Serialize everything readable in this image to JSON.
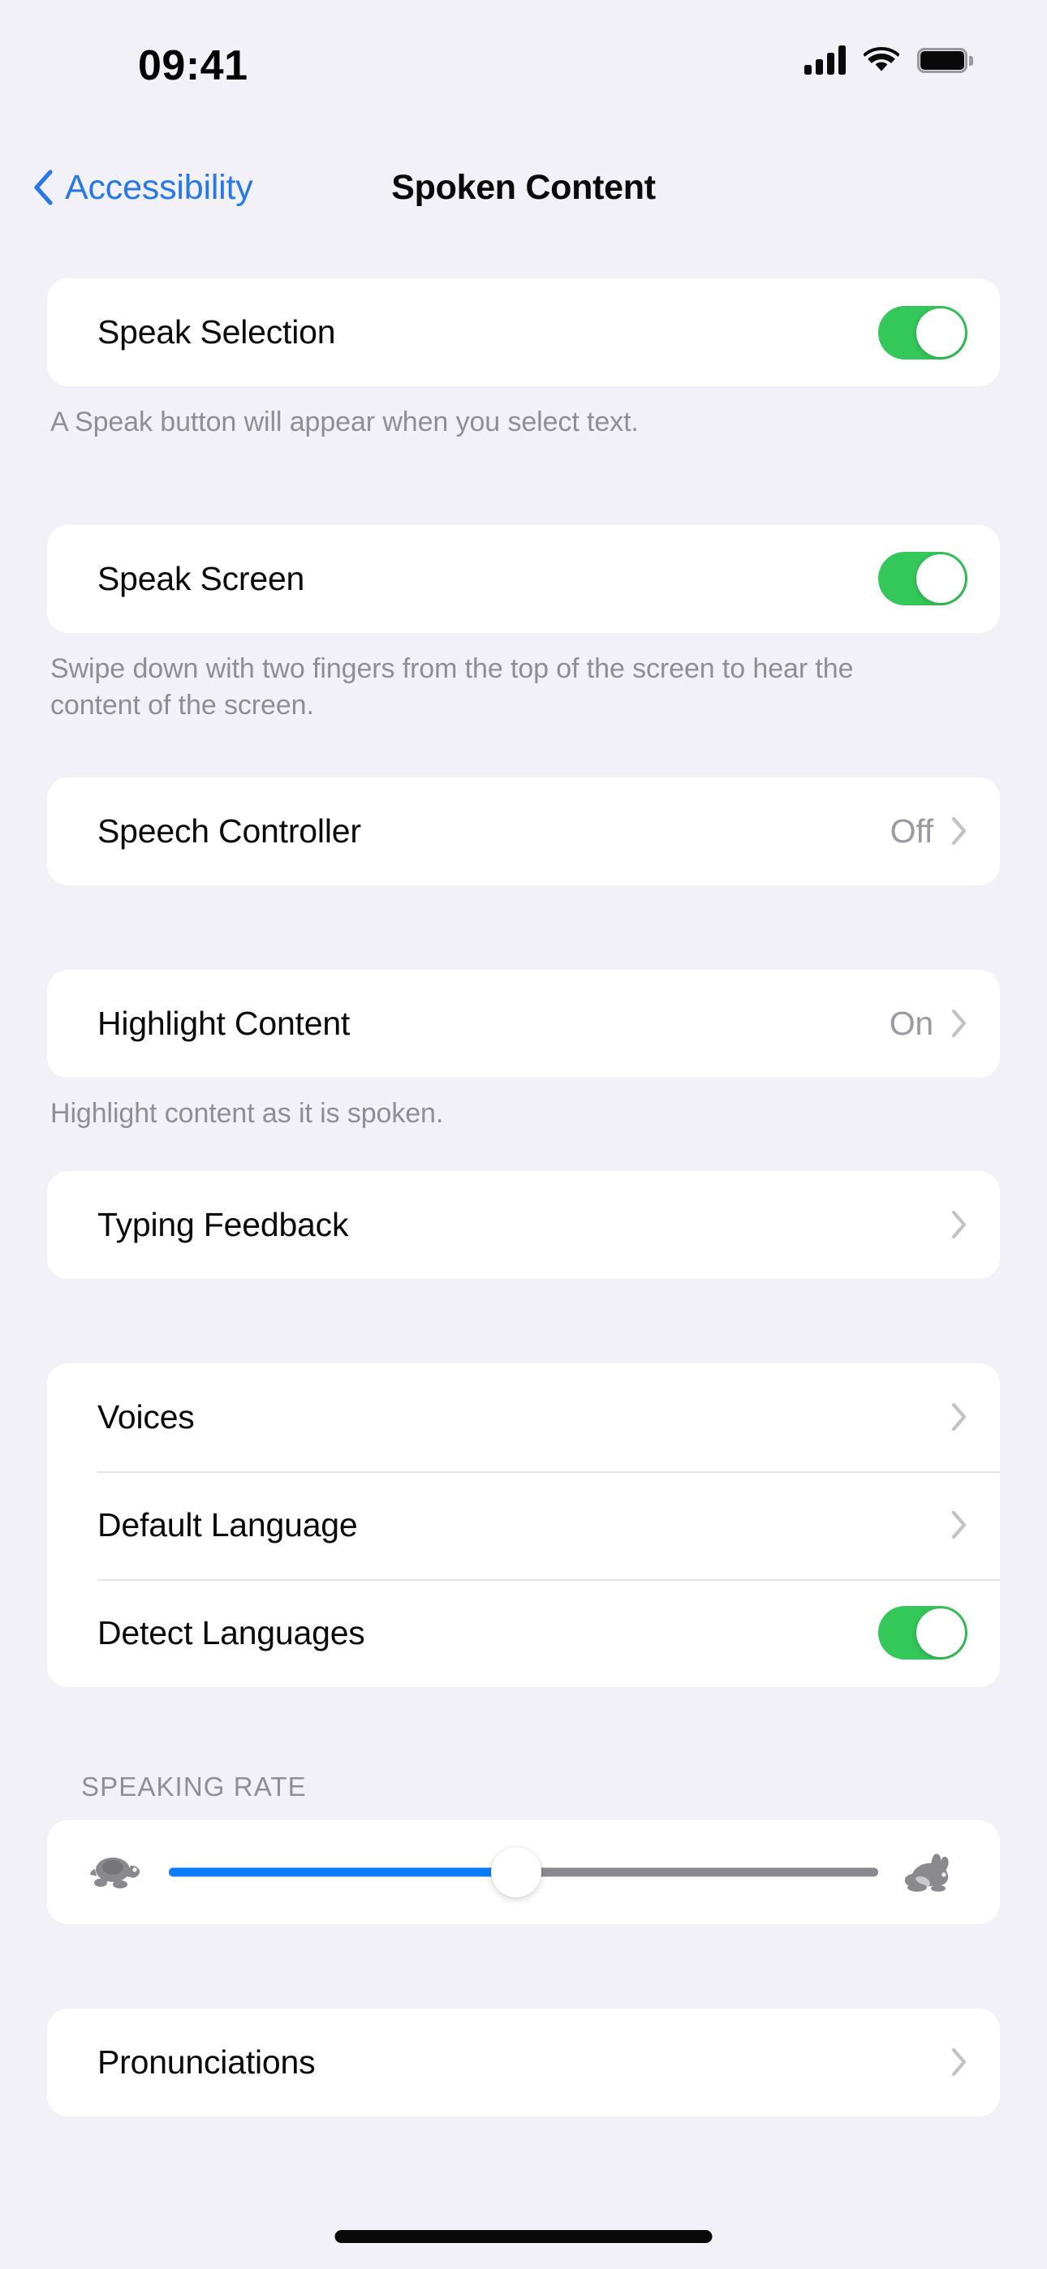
{
  "status_bar": {
    "time": "09:41",
    "cellular_icon": "cellular-signal-icon",
    "cellular_bars": 4,
    "wifi_icon": "wifi-icon",
    "battery_icon": "battery-full-icon",
    "battery_level_percent": 100
  },
  "nav": {
    "back_icon": "chevron-left-icon",
    "back_label": "Accessibility",
    "title": "Spoken Content"
  },
  "colors": {
    "background": "#F1F1F7",
    "cell_background": "#FFFFFF",
    "accent_blue": "#2878E8",
    "toggle_on_green": "#34C759",
    "slider_fill_blue": "#0A7BFF",
    "slider_track_gray": "#8A8A8E",
    "secondary_text": "#8E8E93",
    "primary_text": "#0A0A0A"
  },
  "sections": [
    {
      "id": "speak-selection",
      "rows": [
        {
          "label": "Speak Selection",
          "control": "toggle",
          "toggle_state": "on"
        }
      ],
      "footer": "A Speak button will appear when you select text."
    },
    {
      "id": "speak-screen",
      "rows": [
        {
          "label": "Speak Screen",
          "control": "toggle",
          "toggle_state": "on"
        }
      ],
      "footer": "Swipe down with two fingers from the top of the screen to hear the content of the screen."
    },
    {
      "id": "speech-controller",
      "rows": [
        {
          "label": "Speech Controller",
          "control": "disclosure",
          "value": "Off",
          "chevron_icon": "chevron-right-icon"
        }
      ],
      "footer": ""
    },
    {
      "id": "highlight-content",
      "rows": [
        {
          "label": "Highlight Content",
          "control": "disclosure",
          "value": "On",
          "chevron_icon": "chevron-right-icon"
        }
      ],
      "footer": "Highlight content as it is spoken."
    },
    {
      "id": "typing-feedback",
      "rows": [
        {
          "label": "Typing Feedback",
          "control": "disclosure",
          "value": "",
          "chevron_icon": "chevron-right-icon"
        }
      ],
      "footer": ""
    },
    {
      "id": "voices",
      "rows": [
        {
          "label": "Voices",
          "control": "disclosure",
          "value": "",
          "chevron_icon": "chevron-right-icon"
        },
        {
          "label": "Default Language",
          "control": "disclosure",
          "value": "",
          "chevron_icon": "chevron-right-icon"
        },
        {
          "label": "Detect Languages",
          "control": "toggle",
          "toggle_state": "on"
        }
      ],
      "footer": ""
    }
  ],
  "speaking_rate": {
    "header": "SPEAKING RATE",
    "slow_icon": "tortoise-icon",
    "fast_icon": "hare-icon",
    "value_percent": 49,
    "min_label": "",
    "max_label": ""
  },
  "pronunciations": {
    "label": "Pronunciations",
    "chevron_icon": "chevron-right-icon"
  },
  "home_indicator": "home-indicator"
}
